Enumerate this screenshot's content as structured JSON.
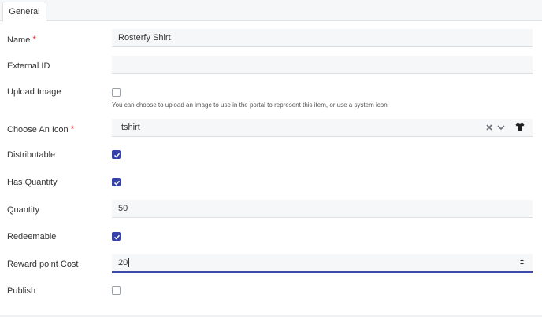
{
  "tabs": [
    {
      "label": "General"
    }
  ],
  "form": {
    "name": {
      "label": "Name",
      "value": "Rosterfy Shirt",
      "required_mark": "*"
    },
    "external_id": {
      "label": "External ID",
      "value": ""
    },
    "upload_image": {
      "label": "Upload Image",
      "checked": false,
      "help": "You can choose to upload an image to use in the portal to represent this item, or use a system icon"
    },
    "choose_icon": {
      "label": "Choose An Icon",
      "value": "tshirt",
      "required_mark": "*",
      "clear_icon": "close-icon",
      "dropdown_icon": "chevron-down-icon",
      "preview_icon": "tshirt-icon"
    },
    "distributable": {
      "label": "Distributable",
      "checked": true
    },
    "has_quantity": {
      "label": "Has Quantity",
      "checked": true
    },
    "quantity": {
      "label": "Quantity",
      "value": "50"
    },
    "redeemable": {
      "label": "Redeemable",
      "checked": true
    },
    "reward_point_cost": {
      "label": "Reward point Cost",
      "value": "20"
    },
    "publish": {
      "label": "Publish",
      "checked": false
    }
  },
  "colors": {
    "accent": "#3742a8",
    "required": "#e03131",
    "field_bg": "#f6f7f9"
  }
}
